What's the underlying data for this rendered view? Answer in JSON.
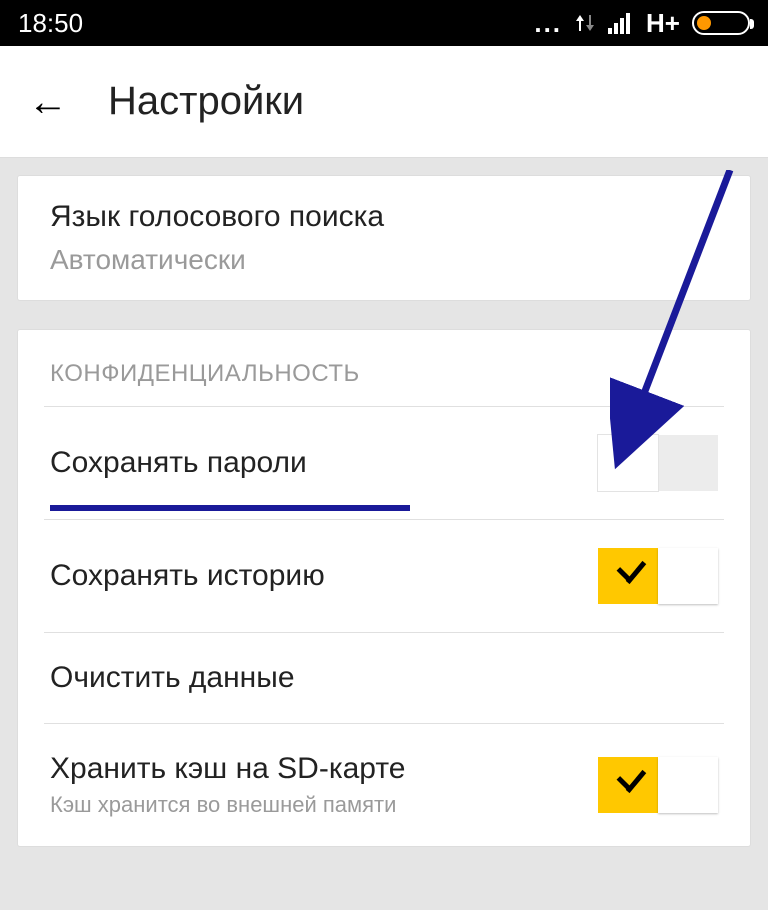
{
  "statusbar": {
    "time": "18:50",
    "network_label": "H+"
  },
  "header": {
    "title": "Настройки"
  },
  "voice_search": {
    "title": "Язык голосового поиска",
    "subtitle": "Автоматически"
  },
  "privacy": {
    "section_title": "КОНФИДЕНЦИАЛЬНОСТЬ",
    "save_passwords": {
      "label": "Сохранять пароли"
    },
    "save_history": {
      "label": "Сохранять историю"
    },
    "clear_data": {
      "label": "Очистить данные"
    },
    "sd_cache": {
      "label": "Хранить кэш на SD-карте",
      "desc": "Кэш хранится во внешней памяти"
    }
  }
}
